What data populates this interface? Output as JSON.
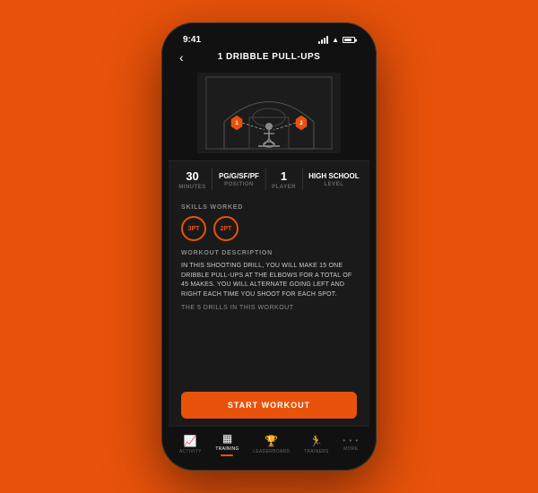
{
  "status_bar": {
    "time": "9:41"
  },
  "header": {
    "back_label": "‹",
    "title": "1 DRIBBLE PULL-UPS"
  },
  "stats": {
    "minutes": "30",
    "minutes_label": "MINUTES",
    "position": "PG/G/SF/PF",
    "position_label": "POSITION",
    "player": "1",
    "player_label": "PLAYER",
    "level": "HIGH SCHOOL",
    "level_label": "LEVEL"
  },
  "skills": {
    "label": "SKILLS WORKED",
    "items": [
      "3PT",
      "2PT"
    ]
  },
  "description": {
    "label": "WORKOUT DESCRIPTION",
    "text": "IN THIS SHOOTING DRILL, YOU WILL MAKE 15 ONE DRIBBLE PULL-UPS AT THE ELBOWS FOR A TOTAL OF 45 MAKES. YOU WILL ALTERNATE GOING LEFT AND RIGHT EACH TIME YOU SHOOT FOR EACH SPOT.",
    "drills_label": "THE 5 DRILLS IN THIS WORKOUT"
  },
  "start_button": {
    "label": "START WORKOUT"
  },
  "nav": {
    "items": [
      {
        "label": "ACTIVITY",
        "icon": "📈",
        "active": false
      },
      {
        "label": "TRAINING",
        "icon": "🖥",
        "active": true
      },
      {
        "label": "LEADERBOARD",
        "icon": "🏆",
        "active": false
      },
      {
        "label": "TRAINERS",
        "icon": "🏃",
        "active": false
      },
      {
        "label": "MORE",
        "icon": "•••",
        "active": false
      }
    ]
  },
  "court": {
    "spot1": "1",
    "spot2": "2"
  }
}
